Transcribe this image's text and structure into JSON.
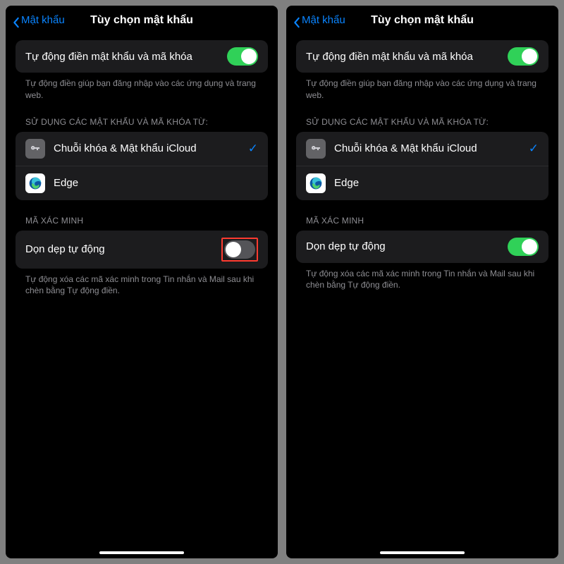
{
  "left": {
    "back_label": "Mật khẩu",
    "title": "Tùy chọn mật khẩu",
    "autofill": {
      "label": "Tự động điền mật khẩu và mã khóa",
      "enabled": true,
      "footer": "Tự động điền giúp bạn đăng nhập vào các ứng dụng và trang web."
    },
    "providers_header": "SỬ DỤNG CÁC MẬT KHẨU VÀ MÃ KHÓA TỪ:",
    "providers": [
      {
        "name": "Chuỗi khóa & Mật khẩu iCloud",
        "icon": "key",
        "checked": true
      },
      {
        "name": "Edge",
        "icon": "edge",
        "checked": false
      }
    ],
    "verify_header": "MÃ XÁC MINH",
    "cleanup": {
      "label": "Dọn dẹp tự động",
      "enabled": false,
      "highlighted": true,
      "footer": "Tự động xóa các mã xác minh trong Tin nhắn và Mail sau khi chèn bằng Tự động điền."
    }
  },
  "right": {
    "back_label": "Mật khẩu",
    "title": "Tùy chọn mật khẩu",
    "autofill": {
      "label": "Tự động điền mật khẩu và mã khóa",
      "enabled": true,
      "footer": "Tự động điền giúp bạn đăng nhập vào các ứng dụng và trang web."
    },
    "providers_header": "SỬ DỤNG CÁC MẬT KHẨU VÀ MÃ KHÓA TỪ:",
    "providers": [
      {
        "name": "Chuỗi khóa & Mật khẩu iCloud",
        "icon": "key",
        "checked": true
      },
      {
        "name": "Edge",
        "icon": "edge",
        "checked": false
      }
    ],
    "verify_header": "MÃ XÁC MINH",
    "cleanup": {
      "label": "Dọn dẹp tự động",
      "enabled": true,
      "highlighted": false,
      "footer": "Tự động xóa các mã xác minh trong Tin nhắn và Mail sau khi chèn bằng Tự động điền."
    }
  }
}
